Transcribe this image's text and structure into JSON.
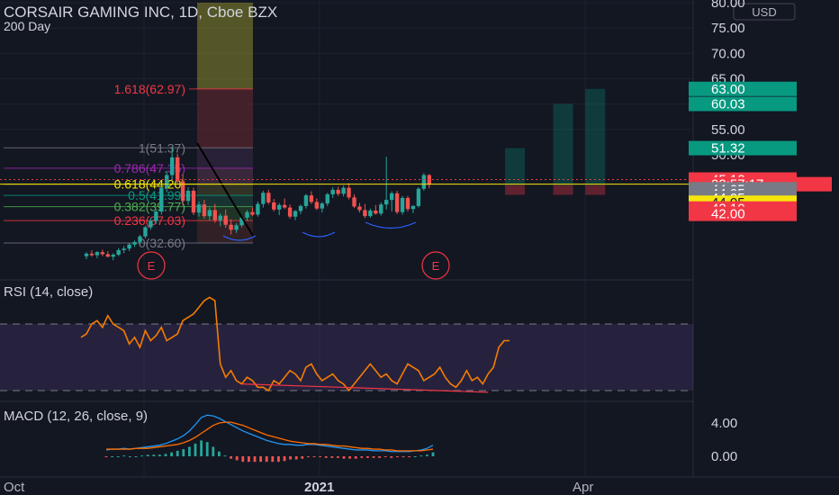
{
  "header": {
    "title": "CORSAIR GAMING INC, 1D, Cboe BZX",
    "subtitle": "200 Day",
    "currency": "USD"
  },
  "price_axis": {
    "ticks": [
      "80.00",
      "75.00",
      "70.00",
      "65.00",
      "60.00",
      "55.00",
      "50.00",
      "44.05"
    ],
    "tags": [
      {
        "label": "63.00",
        "value": 63.0,
        "color": "#089981"
      },
      {
        "label": "60.03",
        "value": 60.03,
        "color": "#089981"
      },
      {
        "label": "51.32",
        "value": 51.32,
        "color": "#089981"
      },
      {
        "label": "45.12",
        "value": 45.12,
        "color": "#f23645"
      },
      {
        "label": "02:57:17",
        "value": 44.2,
        "color": "#f23645"
      },
      {
        "label": "44.05",
        "value": 43.2,
        "color": "#787b86"
      },
      {
        "label": "44.05",
        "value": 42.35,
        "color": "#787b86"
      },
      {
        "label": "44.05",
        "value": 41.5,
        "color": "#787b86"
      },
      {
        "label": "44.05",
        "value": 40.55,
        "color": "#f5e50b"
      },
      {
        "label": "42.10",
        "value": 39.4,
        "color": "#f23645"
      },
      {
        "label": "42.00",
        "value": 38.35,
        "color": "#f23645"
      }
    ]
  },
  "fib_levels": [
    {
      "label": "1.618(62.97)",
      "value": 62.97,
      "color": "#f23645"
    },
    {
      "label": "1(51.37)",
      "value": 51.37,
      "color": "#787b86"
    },
    {
      "label": "0.786(47.35)",
      "value": 47.35,
      "color": "#9c27b0"
    },
    {
      "label": "0.618(44.20)",
      "value": 44.2,
      "color": "#f5e50b"
    },
    {
      "label": "0.5(41.99)",
      "value": 41.99,
      "color": "#089981"
    },
    {
      "label": "0.382(39.77)",
      "value": 39.77,
      "color": "#4caf50"
    },
    {
      "label": "0.236(37.03)",
      "value": 37.03,
      "color": "#f23645"
    },
    {
      "label": "0(32.60)",
      "value": 32.6,
      "color": "#787b86"
    }
  ],
  "earnings_labels": [
    "E",
    "E"
  ],
  "rsi": {
    "label": "RSI (14, close)"
  },
  "macd": {
    "label": "MACD (12, 26, close, 9)",
    "ticks": [
      "4.00",
      "0.00"
    ]
  },
  "time_axis": {
    "ticks": [
      "Oct",
      "2021",
      "Apr"
    ]
  },
  "chart_data": [
    {
      "type": "candlestick",
      "title": "CORSAIR GAMING INC, 1D, Cboe BZX",
      "ylim": [
        28,
        80
      ],
      "candles": [
        [
          30.0,
          30.8,
          29.4,
          30.5
        ],
        [
          30.5,
          31.2,
          29.9,
          30.2
        ],
        [
          30.2,
          31.0,
          29.6,
          30.8
        ],
        [
          30.8,
          31.3,
          30.0,
          30.4
        ],
        [
          30.4,
          31.0,
          29.8,
          29.9
        ],
        [
          29.9,
          30.6,
          29.2,
          30.3
        ],
        [
          30.3,
          31.6,
          30.0,
          31.2
        ],
        [
          31.2,
          32.0,
          30.6,
          31.5
        ],
        [
          31.5,
          32.6,
          31.0,
          32.3
        ],
        [
          32.3,
          33.1,
          31.8,
          32.8
        ],
        [
          32.8,
          34.2,
          32.4,
          33.9
        ],
        [
          33.9,
          36.0,
          33.5,
          35.7
        ],
        [
          35.7,
          37.5,
          35.2,
          37.0
        ],
        [
          37.0,
          39.2,
          36.4,
          38.8
        ],
        [
          38.8,
          44.0,
          38.2,
          43.5
        ],
        [
          43.5,
          46.8,
          42.6,
          46.0
        ],
        [
          46.0,
          51.4,
          44.8,
          49.5
        ],
        [
          49.5,
          50.2,
          44.2,
          44.8
        ],
        [
          44.8,
          46.1,
          40.0,
          40.9
        ],
        [
          40.9,
          43.6,
          40.1,
          42.9
        ],
        [
          42.9,
          43.5,
          38.1,
          38.6
        ],
        [
          38.6,
          40.8,
          37.8,
          40.2
        ],
        [
          40.2,
          41.1,
          37.4,
          37.9
        ],
        [
          37.9,
          39.6,
          37.0,
          39.1
        ],
        [
          39.1,
          40.3,
          36.6,
          37.1
        ],
        [
          37.1,
          38.5,
          35.9,
          38.0
        ],
        [
          38.0,
          39.2,
          35.6,
          36.2
        ],
        [
          36.2,
          37.3,
          34.3,
          35.2
        ],
        [
          35.2,
          36.5,
          34.6,
          36.1
        ],
        [
          36.1,
          38.0,
          35.7,
          37.6
        ],
        [
          37.6,
          39.1,
          37.0,
          38.7
        ],
        [
          38.7,
          39.6,
          37.9,
          38.2
        ],
        [
          38.2,
          40.8,
          37.8,
          40.3
        ],
        [
          40.3,
          42.9,
          39.6,
          42.5
        ],
        [
          42.5,
          43.1,
          40.2,
          40.6
        ],
        [
          40.6,
          41.3,
          38.8,
          39.2
        ],
        [
          39.2,
          40.5,
          38.1,
          40.1
        ],
        [
          40.1,
          41.4,
          39.3,
          39.6
        ],
        [
          39.6,
          40.2,
          37.4,
          37.8
        ],
        [
          37.8,
          39.1,
          37.1,
          38.9
        ],
        [
          38.9,
          40.2,
          38.3,
          39.9
        ],
        [
          39.9,
          42.3,
          39.4,
          42.0
        ],
        [
          42.0,
          42.8,
          40.3,
          40.7
        ],
        [
          40.7,
          41.4,
          39.1,
          39.4
        ],
        [
          39.4,
          40.7,
          38.6,
          40.4
        ],
        [
          40.4,
          42.5,
          39.9,
          42.2
        ],
        [
          42.2,
          43.6,
          41.5,
          43.1
        ],
        [
          43.1,
          43.7,
          41.9,
          42.3
        ],
        [
          42.3,
          43.9,
          41.8,
          43.5
        ],
        [
          43.5,
          44.4,
          41.2,
          41.6
        ],
        [
          41.6,
          42.2,
          39.5,
          39.8
        ],
        [
          39.8,
          40.5,
          38.6,
          39.1
        ],
        [
          39.1,
          40.3,
          37.5,
          37.9
        ],
        [
          37.9,
          39.4,
          37.6,
          39.0
        ],
        [
          39.0,
          40.1,
          38.2,
          38.4
        ],
        [
          38.4,
          40.6,
          38.0,
          40.2
        ],
        [
          40.2,
          49.6,
          39.2,
          41.1
        ],
        [
          41.1,
          42.8,
          38.8,
          42.4
        ],
        [
          42.4,
          42.9,
          38.3,
          38.7
        ],
        [
          38.7,
          41.9,
          38.2,
          41.5
        ],
        [
          41.5,
          41.9,
          38.8,
          39.3
        ],
        [
          39.3,
          40.1,
          38.5,
          39.9
        ],
        [
          39.9,
          43.6,
          39.6,
          43.3
        ],
        [
          43.3,
          46.4,
          42.9,
          46.0
        ],
        [
          46.0,
          46.2,
          43.4,
          44.1
        ]
      ],
      "projection_boxes": [
        {
          "x_bar": 80,
          "top": 51.32,
          "bottom": 44.05
        },
        {
          "x_bar": 89,
          "top": 60.03,
          "bottom": 44.05
        },
        {
          "x_bar": 95,
          "top": 63.0,
          "bottom": 44.05
        }
      ]
    },
    {
      "type": "line",
      "title": "RSI (14, close)",
      "ylim": [
        0,
        100
      ],
      "reference_lines": [
        70,
        30
      ],
      "values": [
        62,
        64,
        70,
        72,
        68,
        75,
        70,
        68,
        66,
        58,
        62,
        56,
        66,
        60,
        63,
        68,
        60,
        62,
        64,
        72,
        74,
        76,
        80,
        84,
        86,
        84,
        46,
        38,
        42,
        36,
        34,
        38,
        36,
        32,
        32,
        30,
        36,
        34,
        38,
        42,
        40,
        36,
        44,
        46,
        40,
        36,
        38,
        40,
        36,
        34,
        30,
        34,
        38,
        42,
        46,
        42,
        38,
        40,
        36,
        34,
        40,
        46,
        44,
        42,
        36,
        38,
        40,
        44,
        38,
        34,
        32,
        36,
        42,
        36,
        38,
        34,
        40,
        44,
        56,
        60,
        60
      ],
      "divergence_line": [
        [
          29,
          34
        ],
        [
          75,
          29
        ]
      ]
    },
    {
      "type": "line",
      "title": "MACD (12, 26, close, 9)",
      "ylim": [
        -1.5,
        6.5
      ],
      "series": [
        {
          "name": "MACD",
          "values": [
            0.8,
            0.9,
            0.9,
            1.0,
            0.9,
            1.0,
            1.1,
            1.2,
            1.3,
            1.4,
            1.6,
            1.9,
            2.2,
            2.6,
            3.2,
            4.0,
            4.9,
            5.2,
            5.1,
            4.8,
            4.4,
            4.0,
            3.6,
            3.2,
            2.9,
            2.6,
            2.3,
            2.0,
            1.8,
            1.6,
            1.5,
            1.5,
            1.4,
            1.4,
            1.5,
            1.5,
            1.4,
            1.3,
            1.2,
            1.1,
            1.0,
            0.9,
            0.8,
            0.8,
            0.8,
            0.7,
            0.7,
            0.7,
            0.6,
            0.6,
            0.6,
            0.6,
            0.7,
            0.8,
            1.0,
            1.4
          ]
        },
        {
          "name": "Signal",
          "values": [
            0.9,
            0.9,
            0.9,
            0.9,
            0.9,
            1.0,
            1.0,
            1.0,
            1.1,
            1.2,
            1.3,
            1.4,
            1.5,
            1.7,
            2.0,
            2.4,
            2.9,
            3.4,
            3.9,
            4.2,
            4.3,
            4.3,
            4.1,
            3.9,
            3.6,
            3.3,
            3.0,
            2.7,
            2.5,
            2.3,
            2.1,
            1.9,
            1.8,
            1.7,
            1.6,
            1.6,
            1.5,
            1.5,
            1.4,
            1.3,
            1.3,
            1.2,
            1.1,
            1.0,
            1.0,
            0.9,
            0.9,
            0.8,
            0.8,
            0.7,
            0.7,
            0.7,
            0.7,
            0.7,
            0.8,
            0.9
          ]
        }
      ],
      "histogram": [
        -0.1,
        0.0,
        0.0,
        0.1,
        0.0,
        0.0,
        0.1,
        0.2,
        0.2,
        0.2,
        0.3,
        0.5,
        0.7,
        0.9,
        1.2,
        1.6,
        2.0,
        1.8,
        1.2,
        0.6,
        0.1,
        -0.3,
        -0.5,
        -0.7,
        -0.7,
        -0.7,
        -0.7,
        -0.7,
        -0.7,
        -0.7,
        -0.6,
        -0.4,
        -0.4,
        -0.3,
        -0.1,
        -0.1,
        -0.1,
        -0.2,
        -0.2,
        -0.2,
        -0.3,
        -0.3,
        -0.3,
        -0.2,
        -0.2,
        -0.2,
        -0.2,
        -0.1,
        -0.2,
        -0.1,
        -0.1,
        -0.1,
        0.0,
        0.1,
        0.2,
        0.5
      ]
    }
  ]
}
